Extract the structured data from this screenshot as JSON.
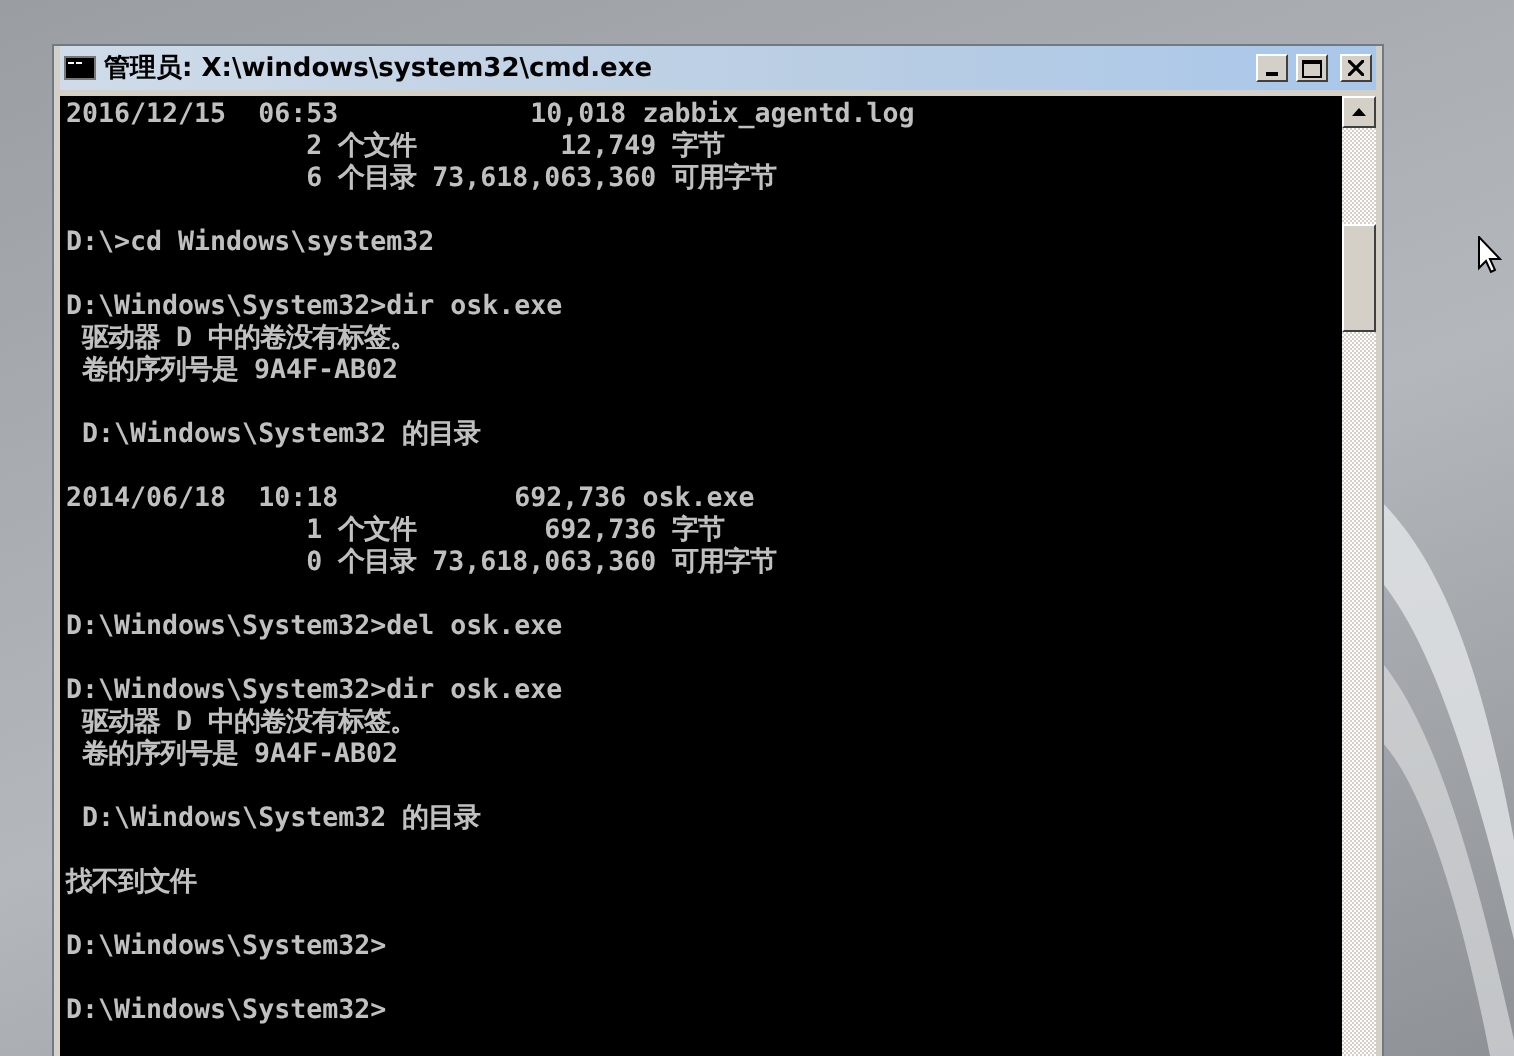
{
  "window": {
    "title": "管理员: X:\\windows\\system32\\cmd.exe"
  },
  "console": {
    "blocks": [
      [
        "2016/12/15  06:53            10,018 zabbix_agentd.log",
        "               2 个文件         12,749 字节",
        "               6 个目录 73,618,063,360 可用字节"
      ],
      [
        "D:\\>cd Windows\\system32"
      ],
      [
        "D:\\Windows\\System32>dir osk.exe",
        " 驱动器 D 中的卷没有标签。",
        " 卷的序列号是 9A4F-AB02"
      ],
      [
        " D:\\Windows\\System32 的目录"
      ],
      [
        "2014/06/18  10:18           692,736 osk.exe",
        "               1 个文件        692,736 字节",
        "               0 个目录 73,618,063,360 可用字节"
      ],
      [
        "D:\\Windows\\System32>del osk.exe"
      ],
      [
        "D:\\Windows\\System32>dir osk.exe",
        " 驱动器 D 中的卷没有标签。",
        " 卷的序列号是 9A4F-AB02"
      ],
      [
        " D:\\Windows\\System32 的目录"
      ],
      [
        "找不到文件"
      ],
      [
        "D:\\Windows\\System32>"
      ],
      [
        "D:\\Windows\\System32>"
      ]
    ]
  }
}
